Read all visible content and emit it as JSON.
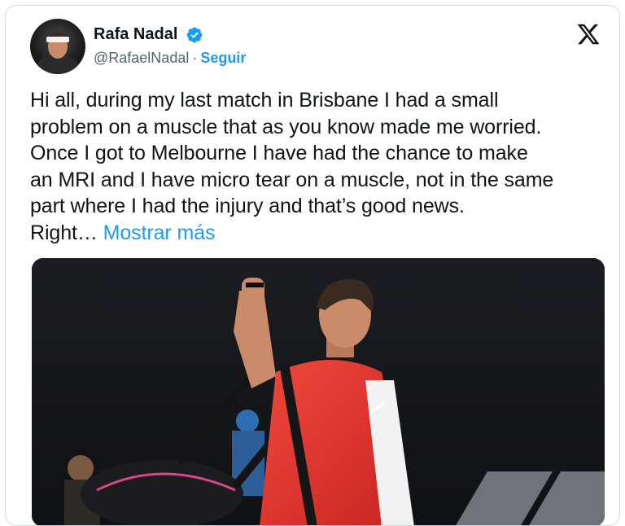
{
  "author": {
    "name": "Rafa Nadal",
    "handle": "@RafaelNadal",
    "separator": "·",
    "follow_label": "Seguir",
    "verified": true,
    "verified_icon": "verified-badge-icon"
  },
  "header": {
    "close_icon": "x-logo-icon"
  },
  "tweet": {
    "lines": [
      "Hi all, during my last match in Brisbane I had a small",
      "problem on a muscle that as you know made me worried.",
      "Once I got to Melbourne I have had the chance to make",
      "an MRI and I have micro tear on a muscle, not in the same",
      "part where I had the injury and that’s good news."
    ],
    "last_line_prefix": "Right…",
    "show_more_label": "Mostrar más"
  },
  "media": {
    "type": "photo",
    "subject": "tennis player waving"
  },
  "colors": {
    "accent": "#1d9bf0",
    "text": "#0f1419",
    "secondary": "#536471",
    "shirt": "#e8322f"
  }
}
